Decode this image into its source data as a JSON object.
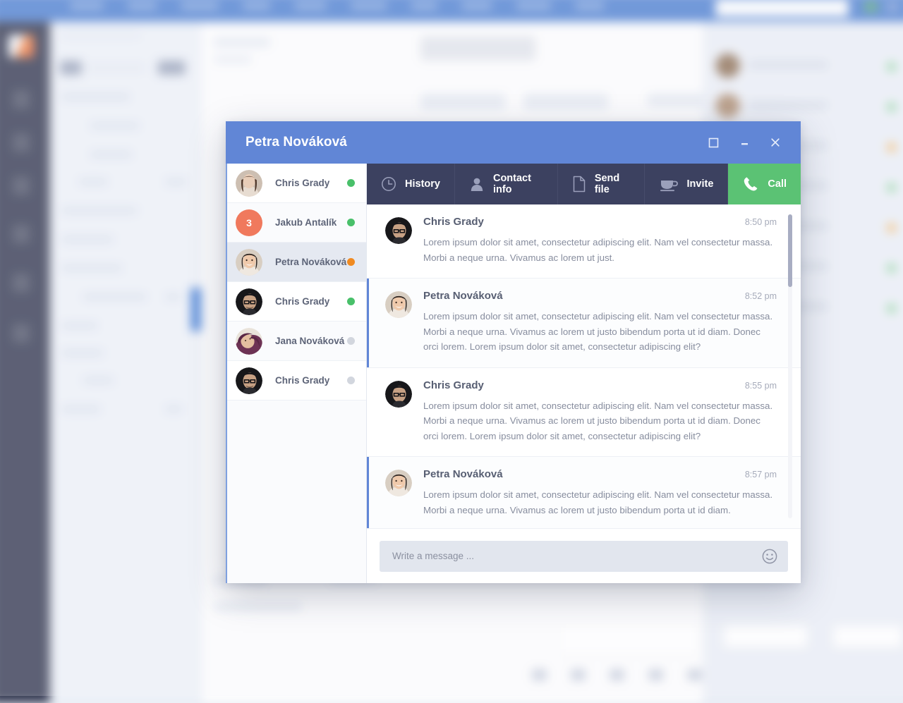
{
  "background_app": {
    "topbar": {
      "color": "#4d7fd0",
      "menu_item_widths": [
        46,
        40,
        52,
        38,
        44,
        50,
        36,
        42,
        48,
        40
      ],
      "search_placeholder": ""
    },
    "sidebar": {
      "color": "#323750",
      "nav_icon_count": 6
    },
    "contacts_panel": {
      "color": "#eaeef6",
      "status_colors": [
        "#8ed49f",
        "#8ed49f",
        "#f2b96a",
        "#8ed49f",
        "#f2b96a",
        "#8ed49f"
      ]
    }
  },
  "modal": {
    "title": "Petra Nováková",
    "title_bar_color": "#6186d6",
    "window_buttons": [
      {
        "name": "maximize",
        "icon": "square-icon"
      },
      {
        "name": "minimize",
        "icon": "minus-icon"
      },
      {
        "name": "close",
        "icon": "close-icon"
      }
    ],
    "contacts": [
      {
        "name": "Chris Grady",
        "status": "online",
        "status_color": "#49c06a",
        "avatar": "woman-dark-hair",
        "badge": null
      },
      {
        "name": "Jakub Antalík",
        "status": "online",
        "status_color": "#49c06a",
        "avatar": null,
        "badge": "3"
      },
      {
        "name": "Petra Nováková",
        "status": "away",
        "status_color": "#f08a21",
        "avatar": "woman-smiling",
        "badge": null,
        "selected": true
      },
      {
        "name": "Chris Grady",
        "status": "online",
        "status_color": "#49c06a",
        "avatar": "man-glasses",
        "badge": null
      },
      {
        "name": "Jana Nováková",
        "status": "offline",
        "status_color": "#d2d6de",
        "avatar": "woman-purple",
        "badge": null
      },
      {
        "name": "Chris Grady",
        "status": "offline",
        "status_color": "#d2d6de",
        "avatar": "man-glasses",
        "badge": null
      }
    ],
    "toolbar": [
      {
        "label": "History",
        "icon": "clock-icon"
      },
      {
        "label": "Contact info",
        "icon": "person-icon"
      },
      {
        "label": "Send file",
        "icon": "document-icon"
      },
      {
        "label": "Invite",
        "icon": "coffee-cup-icon"
      },
      {
        "label": "Call",
        "icon": "phone-icon",
        "accent_color": "#5bc274"
      }
    ],
    "messages": [
      {
        "author": "Chris Grady",
        "time": "8:50 pm",
        "avatar": "man-glasses",
        "accent": false,
        "text": "Lorem ipsum dolor sit amet, consectetur adipiscing elit. Nam vel consectetur massa. Morbi a neque urna. Vivamus ac lorem ut just."
      },
      {
        "author": "Petra Nováková",
        "time": "8:52 pm",
        "avatar": "woman-smiling",
        "accent": true,
        "text": "Lorem ipsum dolor sit amet, consectetur adipiscing elit. Nam vel consectetur massa. Morbi a neque urna. Vivamus ac lorem ut justo bibendum porta ut id diam. Donec orci lorem. Lorem ipsum dolor sit amet, consectetur adipiscing elit?"
      },
      {
        "author": "Chris Grady",
        "time": "8:55 pm",
        "avatar": "man-glasses",
        "accent": false,
        "text": "Lorem ipsum dolor sit amet, consectetur adipiscing elit. Nam vel consectetur massa. Morbi a neque urna. Vivamus ac lorem ut justo bibendum porta ut id diam. Donec orci lorem. Lorem ipsum dolor sit amet, consectetur adipiscing elit?"
      },
      {
        "author": "Petra Nováková",
        "time": "8:57 pm",
        "avatar": "woman-smiling",
        "accent": true,
        "text": "Lorem ipsum dolor sit amet, consectetur adipiscing elit. Nam vel consectetur massa. Morbi a neque urna. Vivamus ac lorem ut justo bibendum porta ut id diam."
      }
    ],
    "scroll_position_percent": 0,
    "composer": {
      "placeholder": "Write a message ...",
      "value": "",
      "emoji_icon": "smiley-icon"
    }
  }
}
